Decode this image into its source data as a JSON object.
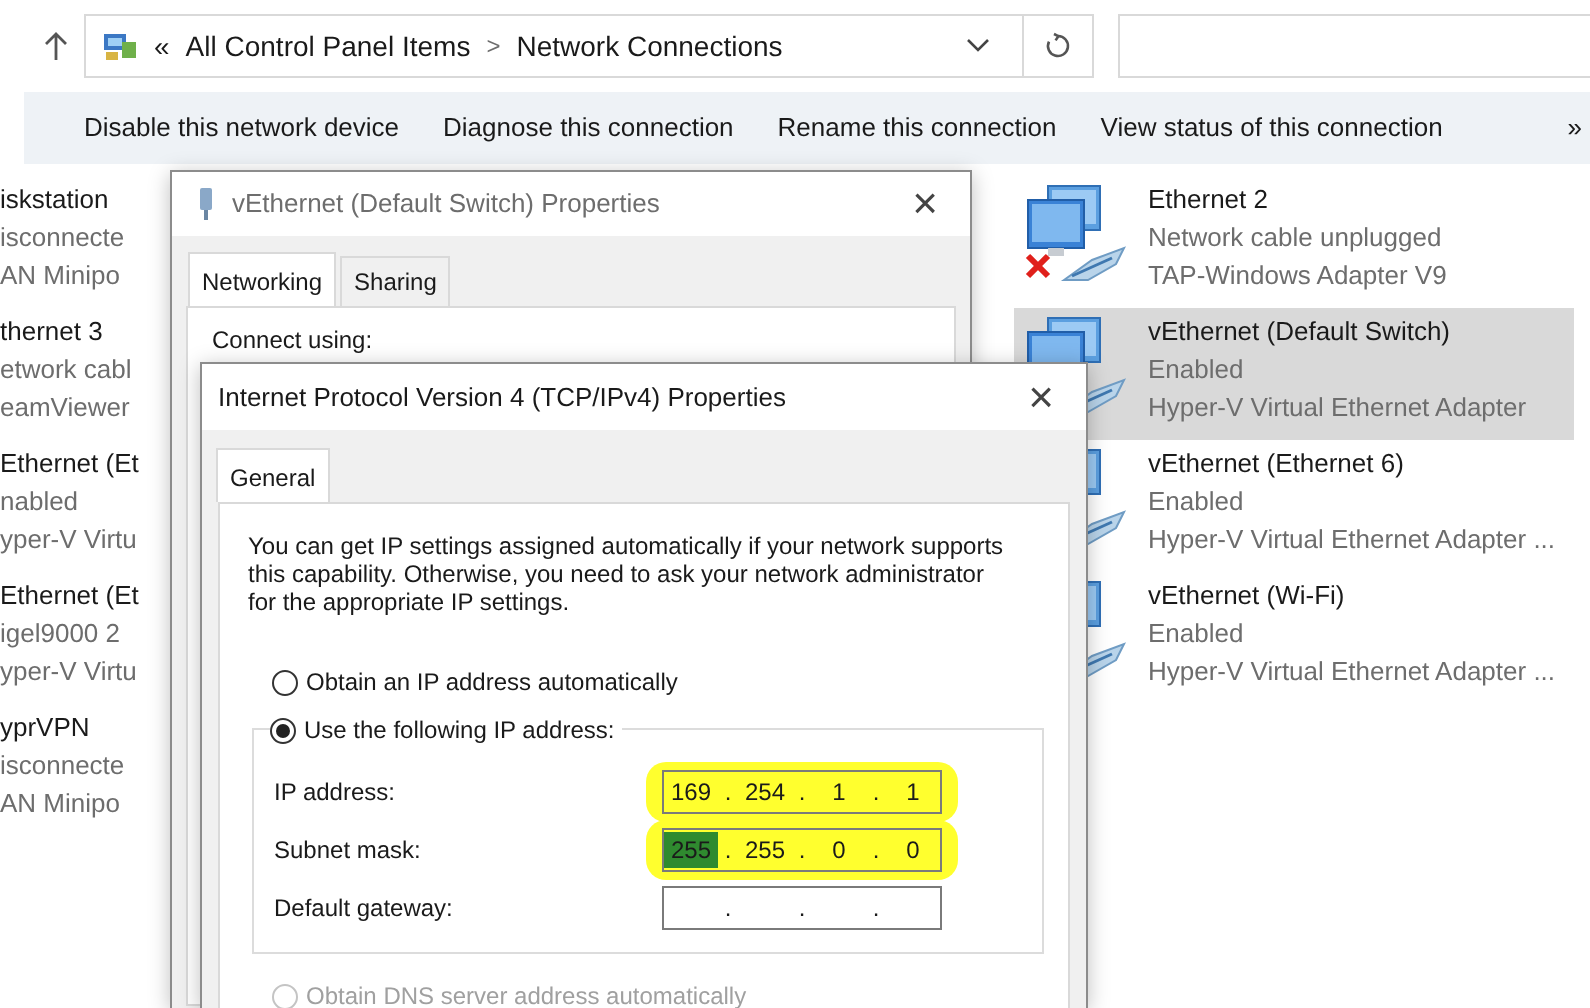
{
  "address_bar": {
    "overflow": "«",
    "separator": ">",
    "crumbs": [
      {
        "label": "All Control Panel Items"
      },
      {
        "label": "Network Connections"
      }
    ]
  },
  "command_bar": {
    "commands": [
      "Disable this network device",
      "Diagnose this connection",
      "Rename this connection",
      "View status of this connection"
    ],
    "overflow": "»"
  },
  "connections_left": [
    {
      "name": "iskstation",
      "status": "isconnecte",
      "device": "AN Minipo"
    },
    {
      "name": "thernet 3",
      "status": "etwork cabl",
      "device": "eamViewer"
    },
    {
      "name": "Ethernet (Et",
      "status": "nabled",
      "device": "yper-V Virtu"
    },
    {
      "name": "Ethernet (Et",
      "status": "igel9000 2",
      "device": "yper-V Virtu"
    },
    {
      "name": "yprVPN",
      "status": "isconnecte",
      "device": "AN Minipo"
    }
  ],
  "connections_right": [
    {
      "name": "Ethernet 2",
      "status": "Network cable unplugged",
      "device": "TAP-Windows Adapter V9",
      "selected": false,
      "unplugged": true
    },
    {
      "name": "vEthernet (Default Switch)",
      "status": "Enabled",
      "device": "Hyper-V Virtual Ethernet Adapter",
      "selected": true,
      "unplugged": false
    },
    {
      "name": "vEthernet (Ethernet 6)",
      "status": "Enabled",
      "device": "Hyper-V Virtual Ethernet Adapter ...",
      "selected": false
    },
    {
      "name": "vEthernet (Wi-Fi)",
      "status": "Enabled",
      "device": "Hyper-V Virtual Ethernet Adapter ...",
      "selected": false
    }
  ],
  "properties_dialog": {
    "title": "vEthernet (Default Switch) Properties",
    "close": "×",
    "tabs": [
      {
        "label": "Networking",
        "selected": true
      },
      {
        "label": "Sharing",
        "selected": false
      }
    ],
    "connect_using": "Connect using:"
  },
  "ipv4_dialog": {
    "title": "Internet Protocol Version 4 (TCP/IPv4) Properties",
    "close": "×",
    "tabs": [
      {
        "label": "General",
        "selected": true
      }
    ],
    "description": "You can get IP settings assigned automatically if your network supports this capability. Otherwise, you need to ask your network administrator for the appropriate IP settings.",
    "ip_options": [
      {
        "label": "Obtain an IP address automatically",
        "selected": false,
        "disabled": false
      },
      {
        "label": "Use the following IP address:",
        "selected": true,
        "disabled": false
      }
    ],
    "dot": ".",
    "fields": [
      {
        "label": "IP address:",
        "highlighted": true,
        "octets": [
          {
            "text": "169",
            "selected": false
          },
          {
            "text": "254",
            "selected": false
          },
          {
            "text": "1",
            "selected": false
          },
          {
            "text": "1",
            "selected": false
          }
        ]
      },
      {
        "label": "Subnet mask:",
        "highlighted": true,
        "octets": [
          {
            "text": "255",
            "selected": true
          },
          {
            "text": "255",
            "selected": false
          },
          {
            "text": "0",
            "selected": false
          },
          {
            "text": "0",
            "selected": false
          }
        ]
      },
      {
        "label": "Default gateway:",
        "highlighted": false
      }
    ],
    "dns_options": [
      {
        "label": "Obtain DNS server address automatically",
        "selected": false,
        "disabled": true
      }
    ]
  }
}
